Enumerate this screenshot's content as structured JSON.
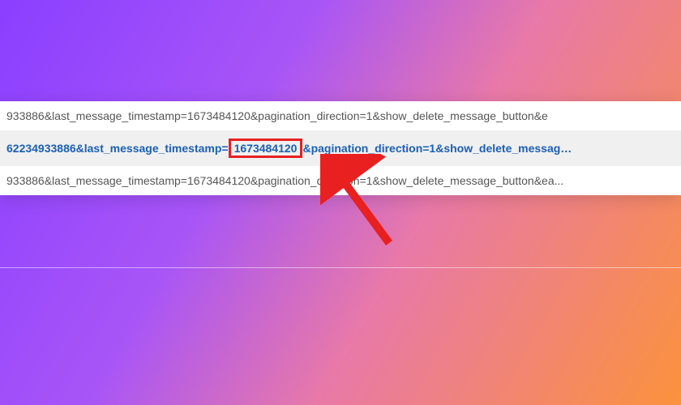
{
  "rows": {
    "r1": {
      "text": "933886&last_message_timestamp=1673484120&pagination_direction=1&show_delete_message_button&e"
    },
    "r2": {
      "prefix": "62234933886&last_message_timestamp=",
      "boxed": "1673484120",
      "suffix": "&pagination_direction=1&show_delete_messag…"
    },
    "r3": {
      "text": "933886&last_message_timestamp=1673484120&pagination_direction=1&show_delete_message_button&ea..."
    }
  },
  "highlighted_value": "1673484120"
}
